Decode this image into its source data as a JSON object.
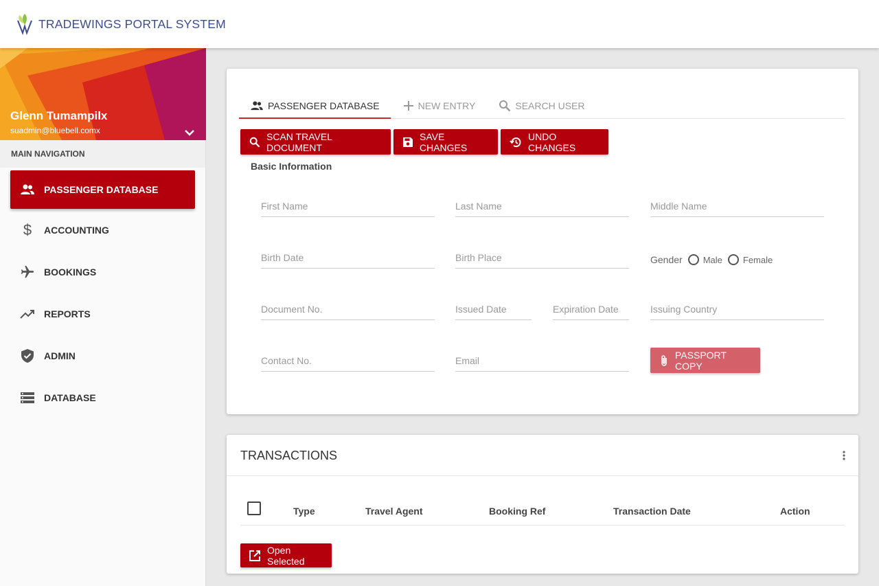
{
  "app": {
    "title": "TRADEWINGS PORTAL SYSTEM"
  },
  "profile": {
    "name": "Glenn Tumampilx",
    "email": "suadmin@bluebell.comx"
  },
  "nav": {
    "header": "MAIN NAVIGATION",
    "items": [
      {
        "label": "PASSENGER DATABASE",
        "icon": "people-icon"
      },
      {
        "label": "ACCOUNTING",
        "icon": "dollar-icon"
      },
      {
        "label": "BOOKINGS",
        "icon": "airplane-icon"
      },
      {
        "label": "REPORTS",
        "icon": "trending-up-icon"
      },
      {
        "label": "ADMIN",
        "icon": "shield-check-icon"
      },
      {
        "label": "DATABASE",
        "icon": "list-icon"
      }
    ]
  },
  "tabs": [
    {
      "label": "PASSENGER DATABASE",
      "icon": "people-icon"
    },
    {
      "label": "NEW ENTRY",
      "icon": "plus-icon"
    },
    {
      "label": "SEARCH USER",
      "icon": "search-icon"
    }
  ],
  "toolbar": {
    "scan_label": "SCAN TRAVEL DOCUMENT",
    "save_label": "SAVE CHANGES",
    "undo_label": "UNDO CHANGES"
  },
  "form": {
    "section_title": "Basic Information",
    "first_name": "First Name",
    "last_name": "Last Name",
    "middle_name": "Middle Name",
    "birth_date": "Birth Date",
    "birth_place": "Birth Place",
    "gender_label": "Gender",
    "gender_male": "Male",
    "gender_female": "Female",
    "document_no": "Document No.",
    "issued_date": "Issued Date",
    "expiration_date": "Expiration Date",
    "issuing_country": "Issuing Country",
    "contact_no": "Contact No.",
    "email": "Email",
    "passport_label": "PASSPORT COPY"
  },
  "transactions": {
    "title": "TRANSACTIONS",
    "columns": [
      "Type",
      "Travel Agent",
      "Booking Ref",
      "Transaction Date",
      "Action"
    ],
    "open_label": "Open Selected"
  },
  "colors": {
    "accent": "#b3000c",
    "brand": "#3b4d8f",
    "passport": "#d4606a"
  }
}
